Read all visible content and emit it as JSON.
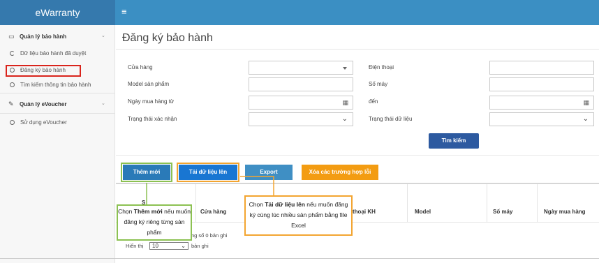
{
  "app": {
    "brand": "eWarranty",
    "menu_icon": "hamburger-icon"
  },
  "sidebar": {
    "groups": [
      {
        "label": "Quản lý bảo hành",
        "icon": "monitor-icon"
      },
      {
        "label": "Quản lý eVoucher",
        "icon": "edit-icon"
      }
    ],
    "items": [
      {
        "label": "Dữ liệu bảo hành đã duyệt"
      },
      {
        "label": "Đăng ký bảo hành",
        "highlight_color": "#d9241c"
      },
      {
        "label": "Tìm kiếm thông tin bảo hành"
      },
      {
        "label": "Sử dụng eVoucher"
      }
    ]
  },
  "page": {
    "title": "Đăng ký bảo hành"
  },
  "filters": {
    "store_label": "Cửa hàng",
    "model_label": "Model sản phẩm",
    "purchase_from_label": "Ngày mua hàng từ",
    "confirm_status_label": "Trạng thái xác nhận",
    "phone_label": "Điện thoại",
    "serial_label": "Số máy",
    "to_label": "đến",
    "data_status_label": "Trạng thái dữ liệu",
    "search_button": "Tìm kiếm"
  },
  "actions": {
    "add_new": "Thêm mới",
    "upload": "Tải dữ liệu lên",
    "export": "Export",
    "delete_errors": "Xóa các trường hợp lỗi"
  },
  "table": {
    "headers": [
      "Cửa hàng",
      "thoại KH",
      "Model",
      "Số máy",
      "Ngày mua hàng"
    ],
    "first_header_fragment": "S",
    "summary": "ng số 0 bản ghi",
    "length_prefix": "Hiển thị",
    "length_value": "10",
    "length_suffix": "bản ghi"
  },
  "callouts": {
    "add": {
      "pre": "Chọn ",
      "bold": "Thêm mới",
      "post": " nếu muốn đăng ký riêng từng sản phẩm",
      "color": "#8cc152"
    },
    "upload": {
      "pre": "Chọn ",
      "bold": "Tải dữ liệu lên",
      "post": " nếu muốn đăng ký cùng lúc nhiều sản phẩm bằng file Excel",
      "color": "#f3a531"
    }
  }
}
